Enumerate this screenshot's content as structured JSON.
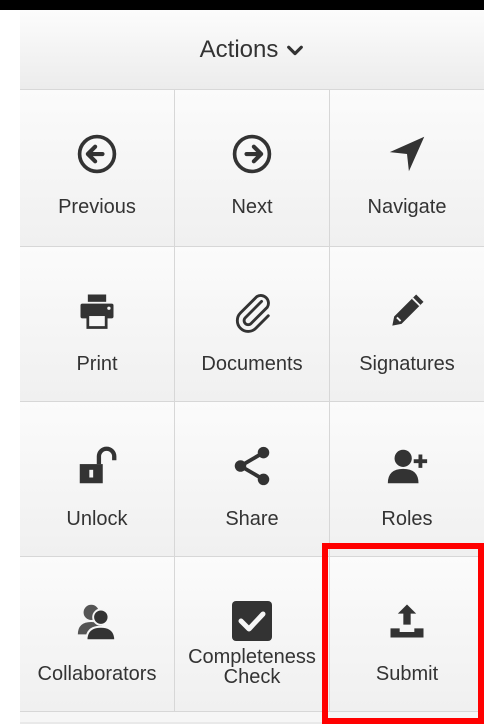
{
  "header": {
    "title": "Actions"
  },
  "tiles": [
    {
      "label": "Previous",
      "icon": "previous-circle-arrow-icon"
    },
    {
      "label": "Next",
      "icon": "next-circle-arrow-icon"
    },
    {
      "label": "Navigate",
      "icon": "navigate-arrow-icon"
    },
    {
      "label": "Print",
      "icon": "printer-icon"
    },
    {
      "label": "Documents",
      "icon": "paperclip-icon"
    },
    {
      "label": "Signatures",
      "icon": "pencil-icon"
    },
    {
      "label": "Unlock",
      "icon": "unlock-icon"
    },
    {
      "label": "Share",
      "icon": "share-icon"
    },
    {
      "label": "Roles",
      "icon": "user-plus-icon"
    },
    {
      "label": "Collaborators",
      "icon": "users-icon"
    },
    {
      "label_line1": "Completeness",
      "label_line2": "Check",
      "icon": "checkbox-icon"
    },
    {
      "label": "Submit",
      "icon": "upload-tray-icon"
    }
  ],
  "colors": {
    "icon": "#333333",
    "highlight": "#ff0000"
  }
}
